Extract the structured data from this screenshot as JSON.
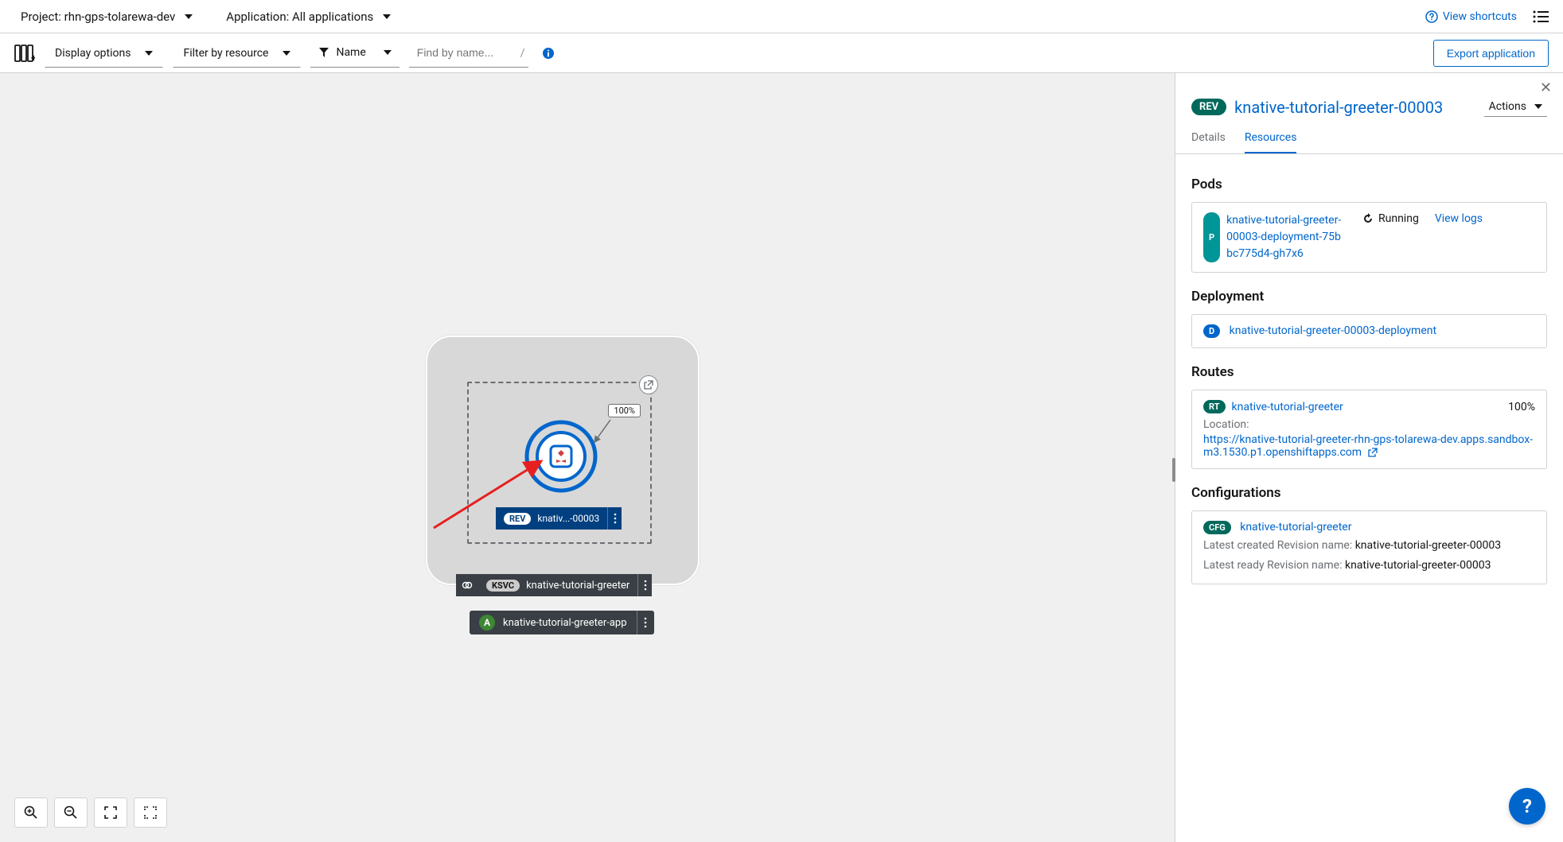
{
  "topbar": {
    "project_label": "Project: rhn-gps-tolarewa-dev",
    "application_label": "Application: All applications",
    "view_shortcuts": "View shortcuts"
  },
  "toolbar": {
    "display_options": "Display options",
    "filter_by_resource": "Filter by resource",
    "name_label": "Name",
    "search_placeholder": "Find by name...",
    "export": "Export application"
  },
  "topology": {
    "traffic_pct": "100%",
    "rev_pill": "REV",
    "rev_label": "knativ...-00003",
    "ksvc_pill": "KSVC",
    "ksvc_label": "knative-tutorial-greeter",
    "app_pill": "A",
    "app_label": "knative-tutorial-greeter-app"
  },
  "panel": {
    "badge": "REV",
    "title": "knative-tutorial-greeter-00003",
    "actions": "Actions",
    "tabs": {
      "details": "Details",
      "resources": "Resources"
    },
    "pods": {
      "heading": "Pods",
      "badge": "P",
      "name": "knative-tutorial-greeter-00003-deployment-75bbc775d4-gh7x6",
      "status": "Running",
      "view_logs": "View logs"
    },
    "deployment": {
      "heading": "Deployment",
      "badge": "D",
      "name": "knative-tutorial-greeter-00003-deployment"
    },
    "routes": {
      "heading": "Routes",
      "badge": "RT",
      "name": "knative-tutorial-greeter",
      "pct": "100%",
      "location_label": "Location:",
      "url": "https://knative-tutorial-greeter-rhn-gps-tolarewa-dev.apps.sandbox-m3.1530.p1.openshiftapps.com"
    },
    "configs": {
      "heading": "Configurations",
      "badge": "CFG",
      "name": "knative-tutorial-greeter",
      "latest_created_label": "Latest created Revision name:",
      "latest_created_value": "knative-tutorial-greeter-00003",
      "latest_ready_label": "Latest ready Revision name:",
      "latest_ready_value": "knative-tutorial-greeter-00003"
    }
  },
  "help": "?"
}
